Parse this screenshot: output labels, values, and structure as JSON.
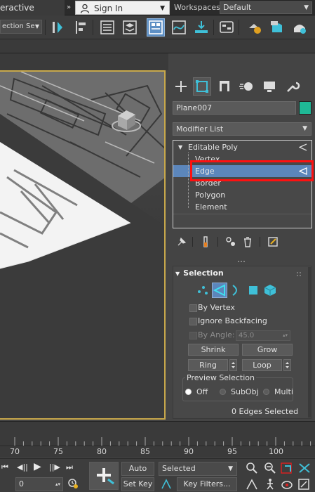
{
  "titlebar": {
    "left_title": "eractive",
    "chevron": "»",
    "signin_label": "Sign In",
    "workspaces_label": "Workspaces:",
    "workspace_value": "Default"
  },
  "toolbar": {
    "selection_set_value": "ection Se"
  },
  "command_panel": {
    "tabs": [
      "create",
      "modify",
      "hierarchy",
      "motion",
      "display",
      "utilities"
    ],
    "active_tab": "modify",
    "object_name": "Plane007",
    "object_color": "#1fb896",
    "modifier_list": "Modifier List",
    "stack": {
      "root": "Editable Poly",
      "items": [
        "Vertex",
        "Edge",
        "Border",
        "Polygon",
        "Element"
      ],
      "selected": "Edge"
    }
  },
  "selection_rollout": {
    "title": "Selection",
    "by_vertex": "By Vertex",
    "ignore_backfacing": "Ignore Backfacing",
    "by_angle_label": "By Angle:",
    "by_angle_value": "45.0",
    "shrink": "Shrink",
    "grow": "Grow",
    "ring": "Ring",
    "loop": "Loop",
    "preview_selection": "Preview Selection",
    "preview_options": [
      "Off",
      "SubObj",
      "Multi"
    ],
    "preview_selected": "Off",
    "status": "0 Edges Selected"
  },
  "timeline": {
    "ruler": [
      "70",
      "75",
      "80",
      "85",
      "90",
      "95",
      "100"
    ]
  },
  "bottom_bar": {
    "frame_value": "0",
    "auto_key": "Auto Key",
    "set_key": "Set Key",
    "selected_dropdown": "Selected",
    "key_filters": "Key Filters..."
  }
}
